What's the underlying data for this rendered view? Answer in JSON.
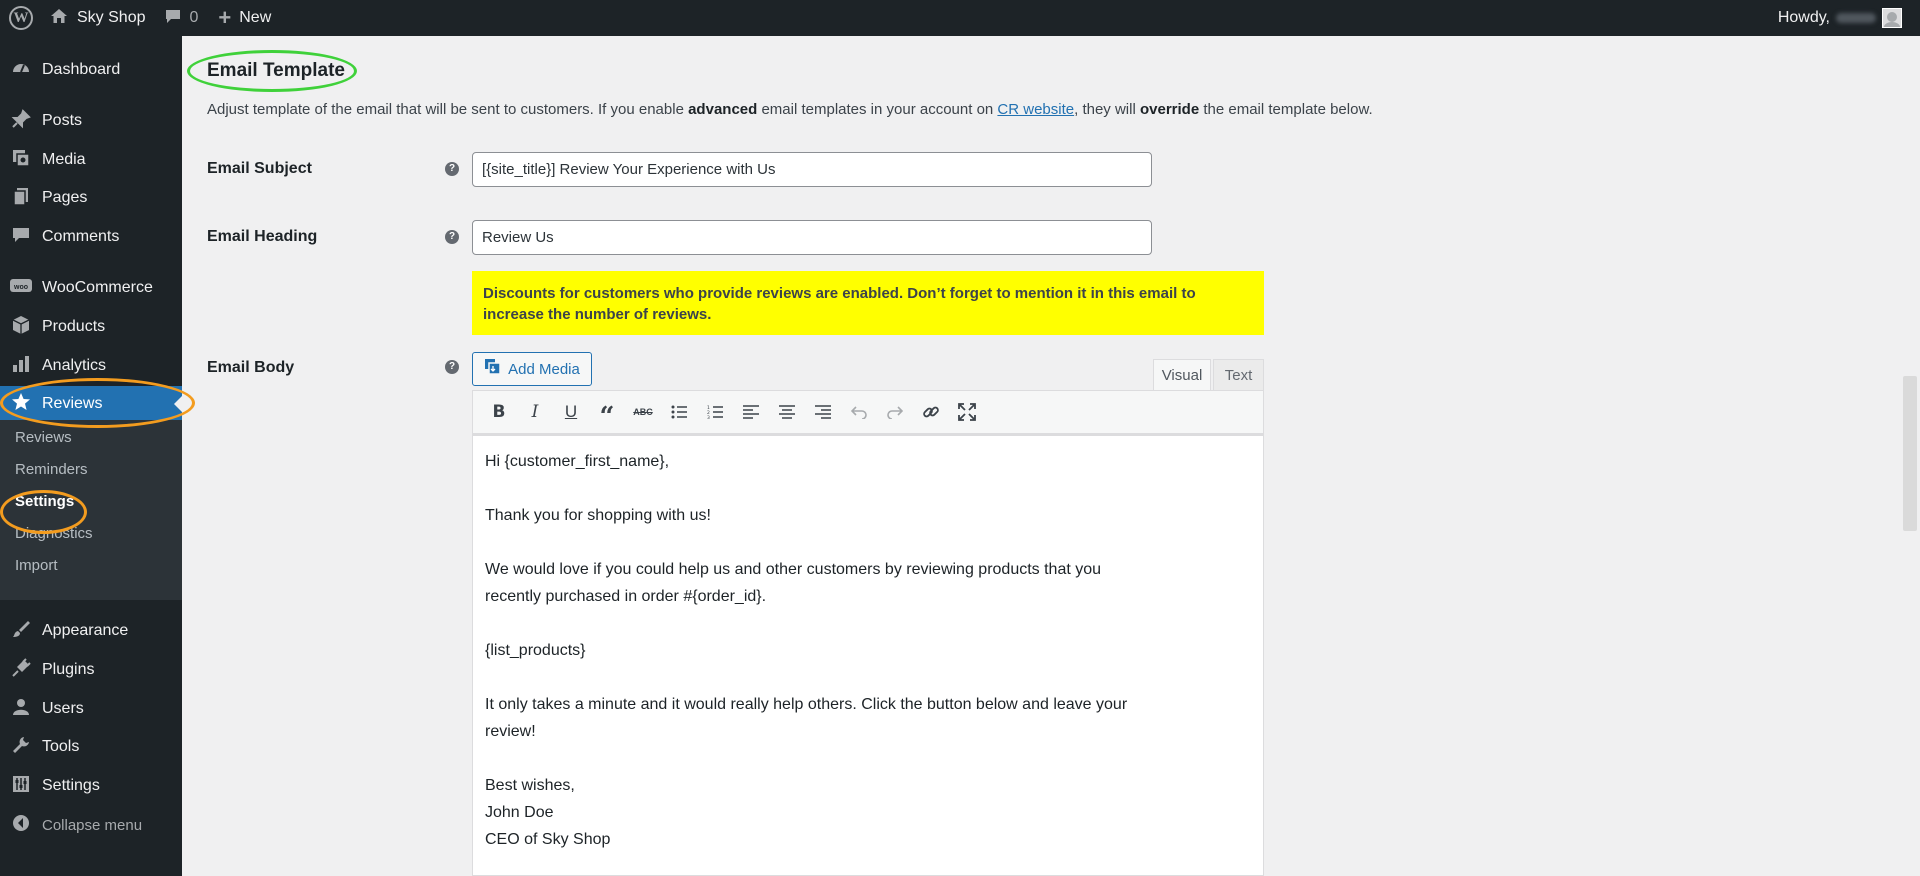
{
  "adminbar": {
    "site_name": "Sky Shop",
    "comments_count": "0",
    "new_label": "New",
    "howdy": "Howdy,"
  },
  "sidebar": {
    "items": [
      {
        "label": "Dashboard",
        "icon": "dashboard-icon"
      },
      {
        "label": "Posts",
        "icon": "pin-icon"
      },
      {
        "label": "Media",
        "icon": "media-icon"
      },
      {
        "label": "Pages",
        "icon": "pages-icon"
      },
      {
        "label": "Comments",
        "icon": "comment-icon"
      },
      {
        "label": "WooCommerce",
        "icon": "woo-icon"
      },
      {
        "label": "Products",
        "icon": "box-icon"
      },
      {
        "label": "Analytics",
        "icon": "bar-chart-icon"
      },
      {
        "label": "Reviews",
        "icon": "star-icon"
      },
      {
        "label": "Appearance",
        "icon": "brush-icon"
      },
      {
        "label": "Plugins",
        "icon": "plug-icon"
      },
      {
        "label": "Users",
        "icon": "user-icon"
      },
      {
        "label": "Tools",
        "icon": "wrench-icon"
      },
      {
        "label": "Settings",
        "icon": "sliders-icon"
      }
    ],
    "submenu": [
      "Reviews",
      "Reminders",
      "Settings",
      "Diagnostics",
      "Import"
    ],
    "collapse_label": "Collapse menu"
  },
  "main": {
    "section_title": "Email Template",
    "description": {
      "part1": "Adjust template of the email that will be sent to customers. If you enable ",
      "bold1": "advanced",
      "part2": " email templates in your account on ",
      "link": "CR website",
      "part3": ", they will ",
      "bold2": "override",
      "part4": " the email template below."
    },
    "subject_label": "Email Subject",
    "subject_value": "[{site_title}] Review Your Experience with Us",
    "heading_label": "Email Heading",
    "heading_value": "Review Us",
    "notice": "Discounts for customers who provide reviews are enabled. Don’t forget to mention it in this email to increase the number of reviews.",
    "body_label": "Email Body",
    "add_media_label": "Add Media",
    "tabs": {
      "visual": "Visual",
      "text": "Text"
    },
    "editor": {
      "line1": "Hi {customer_first_name},",
      "line2": "Thank you for shopping with us!",
      "line3": "We would love if you could help us and other customers by reviewing products that you recently purchased in order #{order_id}.",
      "line4": "{list_products}",
      "line5": "It only takes a minute and it would really help others. Click the button below and leave your review!",
      "line6": "Best wishes,",
      "line7": "John Doe",
      "line8": "CEO of Sky Shop"
    }
  },
  "colors": {
    "sidebar_bg": "#1d2327",
    "active": "#2271b1",
    "notice_bg": "#ffff00",
    "annotation_orange": "#f39c1f",
    "annotation_green": "#3fd13a"
  }
}
